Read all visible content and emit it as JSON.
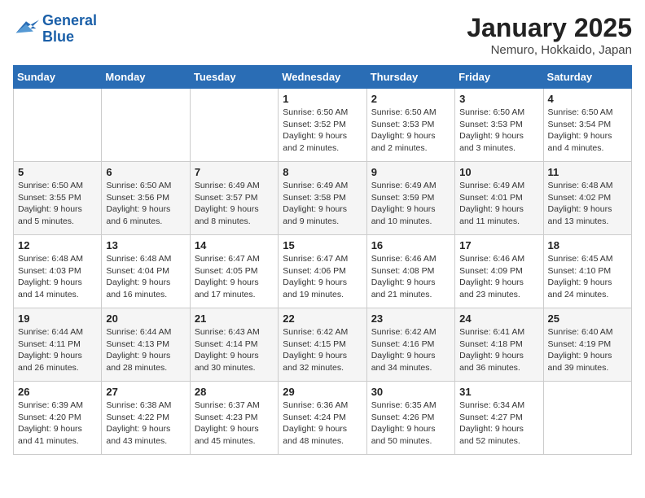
{
  "logo": {
    "line1": "General",
    "line2": "Blue"
  },
  "title": "January 2025",
  "subtitle": "Nemuro, Hokkaido, Japan",
  "days_of_week": [
    "Sunday",
    "Monday",
    "Tuesday",
    "Wednesday",
    "Thursday",
    "Friday",
    "Saturday"
  ],
  "weeks": [
    [
      {
        "day": "",
        "info": ""
      },
      {
        "day": "",
        "info": ""
      },
      {
        "day": "",
        "info": ""
      },
      {
        "day": "1",
        "info": "Sunrise: 6:50 AM\nSunset: 3:52 PM\nDaylight: 9 hours and 2 minutes."
      },
      {
        "day": "2",
        "info": "Sunrise: 6:50 AM\nSunset: 3:53 PM\nDaylight: 9 hours and 2 minutes."
      },
      {
        "day": "3",
        "info": "Sunrise: 6:50 AM\nSunset: 3:53 PM\nDaylight: 9 hours and 3 minutes."
      },
      {
        "day": "4",
        "info": "Sunrise: 6:50 AM\nSunset: 3:54 PM\nDaylight: 9 hours and 4 minutes."
      }
    ],
    [
      {
        "day": "5",
        "info": "Sunrise: 6:50 AM\nSunset: 3:55 PM\nDaylight: 9 hours and 5 minutes."
      },
      {
        "day": "6",
        "info": "Sunrise: 6:50 AM\nSunset: 3:56 PM\nDaylight: 9 hours and 6 minutes."
      },
      {
        "day": "7",
        "info": "Sunrise: 6:49 AM\nSunset: 3:57 PM\nDaylight: 9 hours and 8 minutes."
      },
      {
        "day": "8",
        "info": "Sunrise: 6:49 AM\nSunset: 3:58 PM\nDaylight: 9 hours and 9 minutes."
      },
      {
        "day": "9",
        "info": "Sunrise: 6:49 AM\nSunset: 3:59 PM\nDaylight: 9 hours and 10 minutes."
      },
      {
        "day": "10",
        "info": "Sunrise: 6:49 AM\nSunset: 4:01 PM\nDaylight: 9 hours and 11 minutes."
      },
      {
        "day": "11",
        "info": "Sunrise: 6:48 AM\nSunset: 4:02 PM\nDaylight: 9 hours and 13 minutes."
      }
    ],
    [
      {
        "day": "12",
        "info": "Sunrise: 6:48 AM\nSunset: 4:03 PM\nDaylight: 9 hours and 14 minutes."
      },
      {
        "day": "13",
        "info": "Sunrise: 6:48 AM\nSunset: 4:04 PM\nDaylight: 9 hours and 16 minutes."
      },
      {
        "day": "14",
        "info": "Sunrise: 6:47 AM\nSunset: 4:05 PM\nDaylight: 9 hours and 17 minutes."
      },
      {
        "day": "15",
        "info": "Sunrise: 6:47 AM\nSunset: 4:06 PM\nDaylight: 9 hours and 19 minutes."
      },
      {
        "day": "16",
        "info": "Sunrise: 6:46 AM\nSunset: 4:08 PM\nDaylight: 9 hours and 21 minutes."
      },
      {
        "day": "17",
        "info": "Sunrise: 6:46 AM\nSunset: 4:09 PM\nDaylight: 9 hours and 23 minutes."
      },
      {
        "day": "18",
        "info": "Sunrise: 6:45 AM\nSunset: 4:10 PM\nDaylight: 9 hours and 24 minutes."
      }
    ],
    [
      {
        "day": "19",
        "info": "Sunrise: 6:44 AM\nSunset: 4:11 PM\nDaylight: 9 hours and 26 minutes."
      },
      {
        "day": "20",
        "info": "Sunrise: 6:44 AM\nSunset: 4:13 PM\nDaylight: 9 hours and 28 minutes."
      },
      {
        "day": "21",
        "info": "Sunrise: 6:43 AM\nSunset: 4:14 PM\nDaylight: 9 hours and 30 minutes."
      },
      {
        "day": "22",
        "info": "Sunrise: 6:42 AM\nSunset: 4:15 PM\nDaylight: 9 hours and 32 minutes."
      },
      {
        "day": "23",
        "info": "Sunrise: 6:42 AM\nSunset: 4:16 PM\nDaylight: 9 hours and 34 minutes."
      },
      {
        "day": "24",
        "info": "Sunrise: 6:41 AM\nSunset: 4:18 PM\nDaylight: 9 hours and 36 minutes."
      },
      {
        "day": "25",
        "info": "Sunrise: 6:40 AM\nSunset: 4:19 PM\nDaylight: 9 hours and 39 minutes."
      }
    ],
    [
      {
        "day": "26",
        "info": "Sunrise: 6:39 AM\nSunset: 4:20 PM\nDaylight: 9 hours and 41 minutes."
      },
      {
        "day": "27",
        "info": "Sunrise: 6:38 AM\nSunset: 4:22 PM\nDaylight: 9 hours and 43 minutes."
      },
      {
        "day": "28",
        "info": "Sunrise: 6:37 AM\nSunset: 4:23 PM\nDaylight: 9 hours and 45 minutes."
      },
      {
        "day": "29",
        "info": "Sunrise: 6:36 AM\nSunset: 4:24 PM\nDaylight: 9 hours and 48 minutes."
      },
      {
        "day": "30",
        "info": "Sunrise: 6:35 AM\nSunset: 4:26 PM\nDaylight: 9 hours and 50 minutes."
      },
      {
        "day": "31",
        "info": "Sunrise: 6:34 AM\nSunset: 4:27 PM\nDaylight: 9 hours and 52 minutes."
      },
      {
        "day": "",
        "info": ""
      }
    ]
  ]
}
